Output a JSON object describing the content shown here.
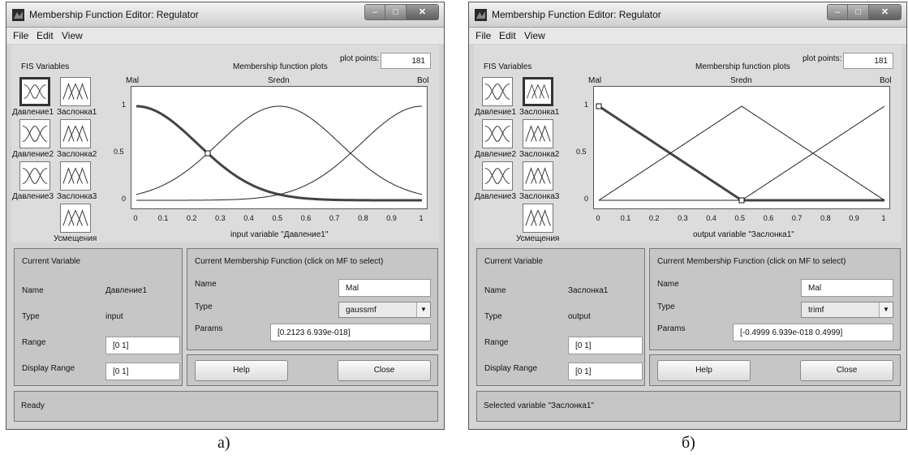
{
  "colors": {
    "window_bg": "#d4d4d4",
    "panel_bg": "#c6c6c6",
    "curve": "#222222",
    "selected_curve": "#444444"
  },
  "windows": [
    {
      "title": "Membership Function Editor: Regulator",
      "menu": [
        "File",
        "Edit",
        "View"
      ],
      "fis_label": "FIS Variables",
      "vars": [
        {
          "label": "Давление1",
          "kind": "input",
          "shape": "gauss",
          "selected": true
        },
        {
          "label": "Заслонка1",
          "kind": "output",
          "shape": "tri",
          "selected": false
        },
        {
          "label": "Давление2",
          "kind": "input",
          "shape": "gauss",
          "selected": false
        },
        {
          "label": "Заслонка2",
          "kind": "output",
          "shape": "tri",
          "selected": false
        },
        {
          "label": "Давление3",
          "kind": "input",
          "shape": "gauss",
          "selected": false
        },
        {
          "label": "Заслонка3",
          "kind": "output",
          "shape": "tri",
          "selected": false
        },
        {
          "label": "Усмещения",
          "kind": "output",
          "shape": "tri",
          "selected": false
        }
      ],
      "plot_title": "Membership function plots",
      "plot_points_label": "plot points:",
      "plot_points": "181",
      "axis_title": "input variable \"Давление1\"",
      "chart_data": {
        "type": "line",
        "xlim": [
          0,
          1
        ],
        "ylim": [
          0,
          1
        ],
        "xticks": [
          "0",
          "0.1",
          "0.2",
          "0.3",
          "0.4",
          "0.5",
          "0.6",
          "0.7",
          "0.8",
          "0.9",
          "1"
        ],
        "yticks": [
          "0",
          "0.5",
          "1"
        ],
        "mf_type": "gaussmf",
        "series": [
          {
            "name": "Mal",
            "sigma": 0.2123,
            "center": 0.0,
            "selected": true
          },
          {
            "name": "Sredn",
            "sigma": 0.2123,
            "center": 0.5,
            "selected": false
          },
          {
            "name": "Bol",
            "sigma": 0.2123,
            "center": 1.0,
            "selected": false
          }
        ],
        "marker_points": [
          [
            0.25,
            0.5
          ]
        ]
      },
      "current_variable": {
        "heading": "Current Variable",
        "name_label": "Name",
        "name": "Давление1",
        "type_label": "Type",
        "type": "input",
        "range_label": "Range",
        "range": "[0 1]",
        "display_range_label": "Display Range",
        "display_range": "[0 1]"
      },
      "current_mf": {
        "heading": "Current Membership Function (click on MF to select)",
        "name_label": "Name",
        "name": "Mal",
        "type_label": "Type",
        "type": "gaussmf",
        "params_label": "Params",
        "params": "[0.2123 6.939e-018]"
      },
      "help_label": "Help",
      "close_label": "Close",
      "status": "Ready",
      "caption": "а)"
    },
    {
      "title": "Membership Function Editor: Regulator",
      "menu": [
        "File",
        "Edit",
        "View"
      ],
      "fis_label": "FIS Variables",
      "vars": [
        {
          "label": "Давление1",
          "kind": "input",
          "shape": "gauss",
          "selected": false
        },
        {
          "label": "Заслонка1",
          "kind": "output",
          "shape": "tri",
          "selected": true
        },
        {
          "label": "Давление2",
          "kind": "input",
          "shape": "gauss",
          "selected": false
        },
        {
          "label": "Заслонка2",
          "kind": "output",
          "shape": "tri",
          "selected": false
        },
        {
          "label": "Давление3",
          "kind": "input",
          "shape": "gauss",
          "selected": false
        },
        {
          "label": "Заслонка3",
          "kind": "output",
          "shape": "tri",
          "selected": false
        },
        {
          "label": "Усмещения",
          "kind": "output",
          "shape": "tri",
          "selected": false
        }
      ],
      "plot_title": "Membership function plots",
      "plot_points_label": "plot points:",
      "plot_points": "181",
      "axis_title": "output variable \"Заслонка1\"",
      "chart_data": {
        "type": "line",
        "xlim": [
          0,
          1
        ],
        "ylim": [
          0,
          1
        ],
        "xticks": [
          "0",
          "0.1",
          "0.2",
          "0.3",
          "0.4",
          "0.5",
          "0.6",
          "0.7",
          "0.8",
          "0.9",
          "1"
        ],
        "yticks": [
          "0",
          "0.5",
          "1"
        ],
        "mf_type": "trimf",
        "series": [
          {
            "name": "Mal",
            "params": [
              -0.4999,
              0.0,
              0.4999
            ],
            "selected": true
          },
          {
            "name": "Sredn",
            "params": [
              0.0,
              0.5,
              1.0
            ],
            "selected": false
          },
          {
            "name": "Bol",
            "params": [
              0.5,
              1.0,
              1.5
            ],
            "selected": false
          }
        ],
        "marker_points": [
          [
            0.0,
            1.0
          ],
          [
            0.5,
            0.0
          ]
        ]
      },
      "current_variable": {
        "heading": "Current Variable",
        "name_label": "Name",
        "name": "Заслонка1",
        "type_label": "Type",
        "type": "output",
        "range_label": "Range",
        "range": "[0 1]",
        "display_range_label": "Display Range",
        "display_range": "[0 1]"
      },
      "current_mf": {
        "heading": "Current Membership Function (click on MF to select)",
        "name_label": "Name",
        "name": "Mal",
        "type_label": "Type",
        "type": "trimf",
        "params_label": "Params",
        "params": "[-0.4999 6.939e-018 0.4999]"
      },
      "help_label": "Help",
      "close_label": "Close",
      "status": "Selected variable \"Заслонка1\"",
      "caption": "б)"
    }
  ]
}
